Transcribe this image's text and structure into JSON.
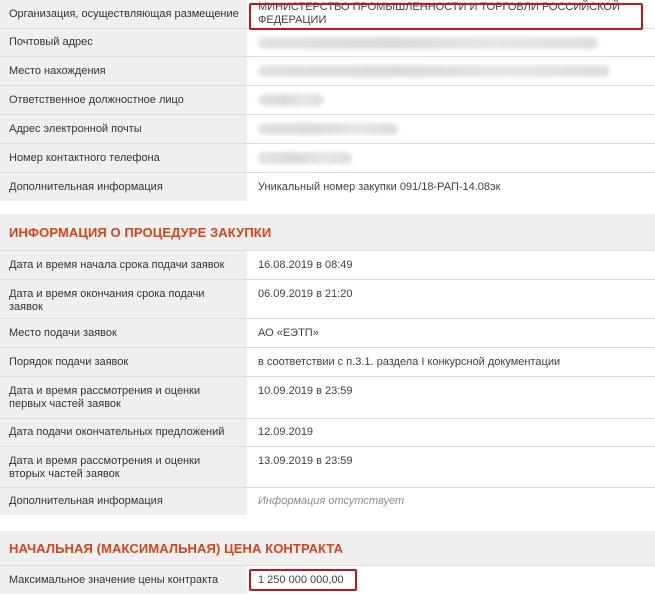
{
  "organizer": {
    "rows": [
      {
        "label": "Организация, осуществляющая размещение",
        "value": "МИНИСТЕРСТВО ПРОМЫШЛЕННОСТИ И ТОРГОВЛИ РОССИЙСКОЙ ФЕДЕРАЦИИ"
      },
      {
        "label": "Почтовый адрес",
        "value": ""
      },
      {
        "label": "Место нахождения",
        "value": ""
      },
      {
        "label": "Ответственное должностное лицо",
        "value": ""
      },
      {
        "label": "Адрес электронной почты",
        "value": ""
      },
      {
        "label": "Номер контактного телефона",
        "value": ""
      },
      {
        "label": "Дополнительная информация",
        "value": "Уникальный номер закупки 091/18-РАП-14.08эк"
      }
    ]
  },
  "procedure": {
    "title": "ИНФОРМАЦИЯ О ПРОЦЕДУРЕ ЗАКУПКИ",
    "rows": [
      {
        "label": "Дата и время начала срока подачи заявок",
        "value": "16.08.2019 в 08:49"
      },
      {
        "label": "Дата и время окончания срока подачи заявок",
        "value": "06.09.2019 в 21:20"
      },
      {
        "label": "Место подачи заявок",
        "value": "АО «ЕЭТП»"
      },
      {
        "label": "Порядок подачи заявок",
        "value": "в соответствии с п.3.1. раздела I конкурсной документации"
      },
      {
        "label": "Дата и время рассмотрения и оценки первых частей заявок",
        "value": "10.09.2019 в 23:59"
      },
      {
        "label": "Дата подачи окончательных предложений",
        "value": "12.09.2019"
      },
      {
        "label": "Дата и время рассмотрения и оценки вторых частей заявок",
        "value": "13.09.2019 в 23:59"
      },
      {
        "label": "Дополнительная информация",
        "value": "Информация отсутствует"
      }
    ]
  },
  "price": {
    "title": "НАЧАЛЬНАЯ (МАКСИМАЛЬНАЯ) ЦЕНА КОНТРАКТА",
    "rows": [
      {
        "label": "Максимальное значение цены контракта",
        "value": "1 250 000 000,00"
      }
    ]
  },
  "colors": {
    "accent": "#d2451f",
    "highlight": "#c8121e",
    "label_bg": "#efefef"
  }
}
